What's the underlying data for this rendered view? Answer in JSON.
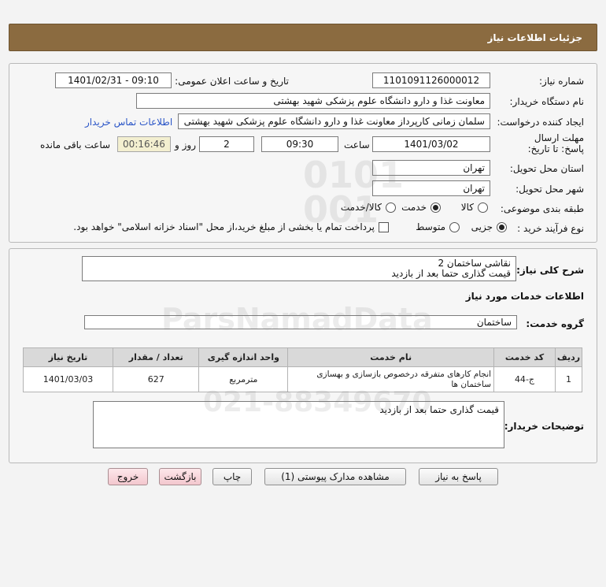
{
  "header": {
    "title": "جزئیات اطلاعات نیاز"
  },
  "form": {
    "need_number_label": "شماره نیاز:",
    "need_number": "1101091126000012",
    "announce_label": "تاریخ و ساعت اعلان عمومی:",
    "announce_value": "1401/02/31 - 09:10",
    "buyer_org_label": "نام دستگاه خریدار:",
    "buyer_org": "معاونت غذا و دارو دانشگاه علوم پزشکی شهید بهشتی",
    "requester_label": "ایجاد کننده درخواست:",
    "requester": "سلمان زمانی کارپرداز معاونت غذا و دارو دانشگاه علوم پزشکی شهید بهشتی",
    "contact_link": "اطلاعات تماس خریدار",
    "deadline_label": "مهلت ارسال پاسخ: تا تاریخ:",
    "deadline_date": "1401/03/02",
    "time_label": "ساعت",
    "deadline_time": "09:30",
    "days_value": "2",
    "days_label": "روز و",
    "remaining_time": "00:16:46",
    "remaining_label": "ساعت باقی مانده",
    "province_label": "استان محل تحویل:",
    "province": "تهران",
    "city_label": "شهر محل تحویل:",
    "city": "تهران",
    "category_label": "طبقه بندی موضوعی:",
    "category_options": [
      "کالا",
      "خدمت",
      "کالا/خدمت"
    ],
    "process_label": "نوع فرآیند خرید :",
    "process_options": [
      "جزیی",
      "متوسط"
    ],
    "payment_note": "پرداخت تمام یا بخشی از مبلغ خرید،از محل \"اسناد خزانه اسلامی\" خواهد بود."
  },
  "description": {
    "label": "شرح کلی نیاز:",
    "line1": "نقاشی ساختمان 2",
    "line2": "قیمت گذاری حتما بعد از بازدید"
  },
  "services": {
    "section_title": "اطلاعات خدمات مورد نیاز",
    "group_label": "گروه خدمت:",
    "group_value": "ساختمان",
    "table": {
      "headers": [
        "ردیف",
        "کد خدمت",
        "نام خدمت",
        "واحد اندازه گیری",
        "تعداد / مقدار",
        "تاریخ نیاز"
      ],
      "rows": [
        [
          "1",
          "ج-44",
          "انجام کارهای متفرقه درخصوص بازسازی و بهسازی ساختمان ها",
          "مترمربع",
          "627",
          "1401/03/03"
        ]
      ]
    }
  },
  "buyer_notes": {
    "label": "توضیحات خریدار:",
    "text": "قیمت گذاری حتما بعد از بازدید"
  },
  "buttons": {
    "reply": "پاسخ به نیاز",
    "attachments": "مشاهده مدارک پیوستی (1)",
    "print": "چاپ",
    "back": "بازگشت",
    "exit": "خروج"
  }
}
